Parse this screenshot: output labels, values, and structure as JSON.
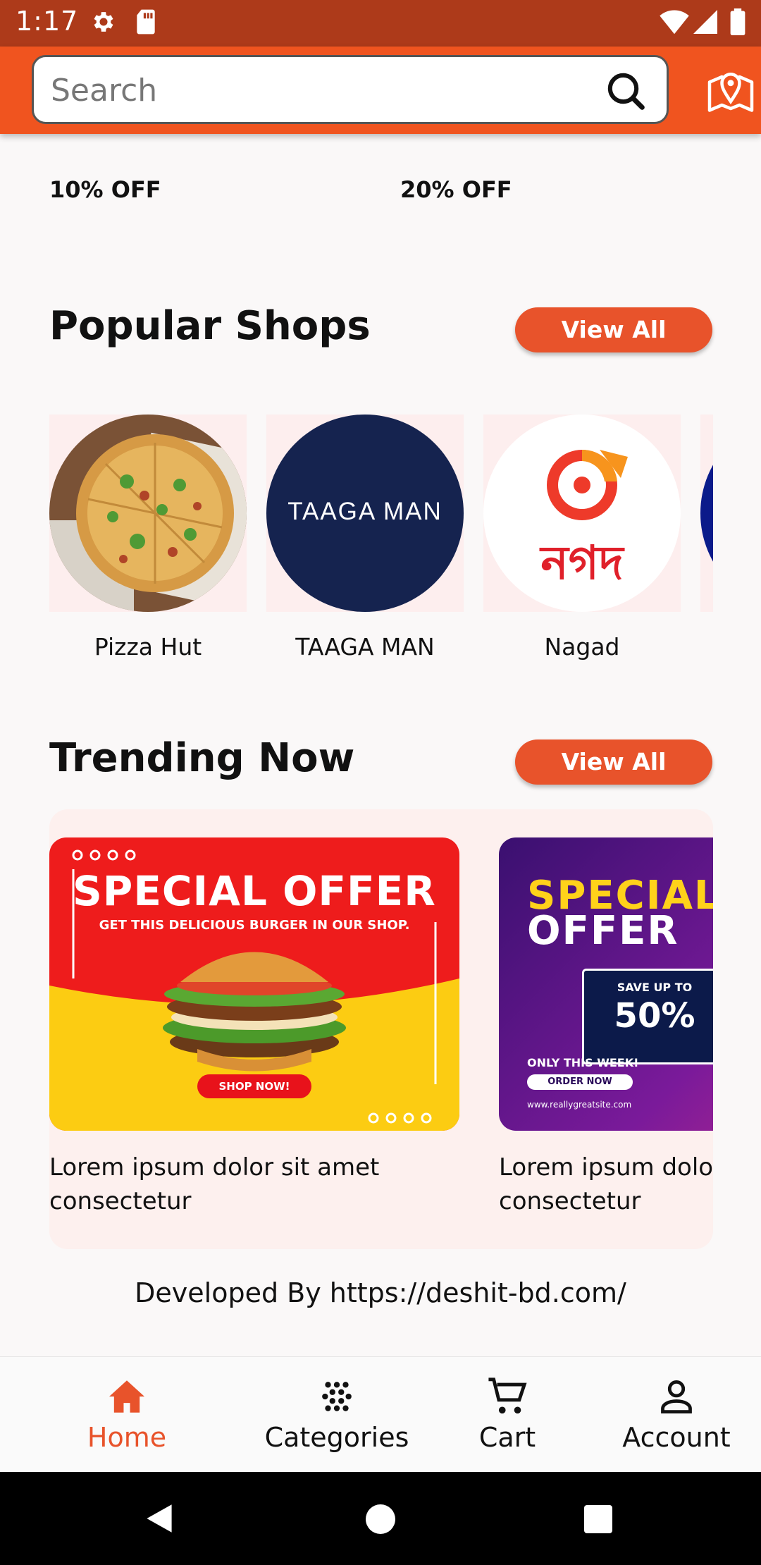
{
  "status_bar": {
    "time": "1:17"
  },
  "search": {
    "placeholder": "Search"
  },
  "offers": {
    "left": "10% OFF",
    "right": "20% OFF"
  },
  "popular": {
    "title": "Popular Shops",
    "view_all": "View All",
    "shops": [
      {
        "name": "Pizza Hut"
      },
      {
        "name": "TAAGA MAN",
        "logo_text": "TAAGA MAN"
      },
      {
        "name": "Nagad",
        "logo_text": "নগদ"
      }
    ]
  },
  "trending": {
    "title": "Trending Now",
    "view_all": "View All",
    "cards": [
      {
        "heading": "SPECIAL OFFER",
        "sub": "GET THIS DELICIOUS BURGER IN OUR SHOP.",
        "cta": "SHOP NOW!",
        "caption": "Lorem ipsum dolor sit amet consectetur"
      },
      {
        "heading1": "SPECIAL",
        "heading2": "OFFER",
        "save_label": "SAVE UP TO",
        "save_value": "50%",
        "week": "ONLY THIS WEEK!",
        "cta": "ORDER NOW",
        "site": "www.reallygreatsite.com",
        "caption": "Lorem ipsum dolor sit amet consectetur"
      }
    ]
  },
  "footer": {
    "text": "Developed By https://deshit-bd.com/"
  },
  "bottom_nav": [
    {
      "label": "Home",
      "icon": "home-icon",
      "active": true
    },
    {
      "label": "Categories",
      "icon": "categories-icon"
    },
    {
      "label": "Cart",
      "icon": "cart-icon"
    },
    {
      "label": "Account",
      "icon": "account-icon"
    }
  ],
  "colors": {
    "accent": "#f0541f",
    "status_bar": "#ad3a1a",
    "button": "#e8532b"
  }
}
